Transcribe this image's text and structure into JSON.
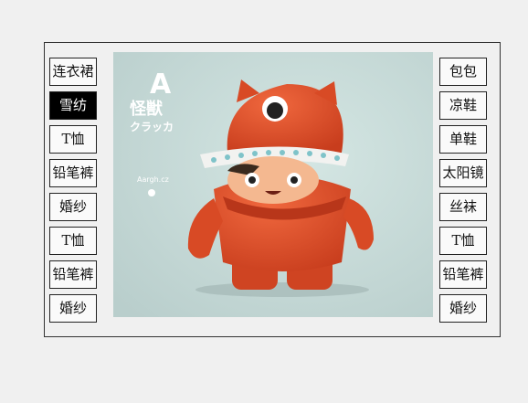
{
  "left_menu": [
    {
      "label": "连衣裙",
      "active": false
    },
    {
      "label": "雪纺",
      "active": true
    },
    {
      "label": "T恤",
      "active": false
    },
    {
      "label": "铅笔裤",
      "active": false
    },
    {
      "label": "婚纱",
      "active": false
    },
    {
      "label": "T恤",
      "active": false
    },
    {
      "label": "铅笔裤",
      "active": false
    },
    {
      "label": "婚纱",
      "active": false
    }
  ],
  "right_menu": [
    {
      "label": "包包"
    },
    {
      "label": "凉鞋"
    },
    {
      "label": "单鞋"
    },
    {
      "label": "太阳镜"
    },
    {
      "label": "丝袜"
    },
    {
      "label": "T恤"
    },
    {
      "label": "铅笔裤"
    },
    {
      "label": "婚纱"
    }
  ],
  "image": {
    "logo_letter": "A",
    "brand_kanji": "怪獣",
    "brand_kana": "クラッカ",
    "brand_url": "Aargh.cz"
  },
  "colors": {
    "active_bg": "#000000",
    "active_text": "#ffffff",
    "image_bg": "#c4d7d5",
    "figure_orange": "#e2502a"
  }
}
